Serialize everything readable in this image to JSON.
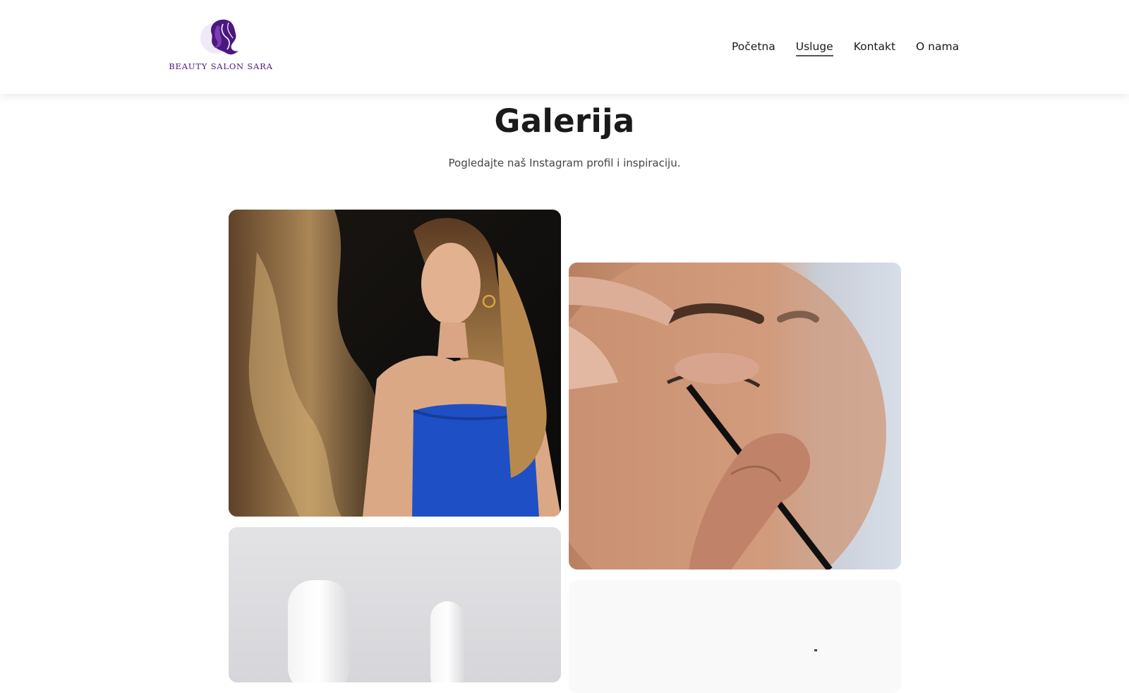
{
  "brand": {
    "name": "BEAUTY SALON SARA",
    "logo_icon": "woman-silhouette-icon",
    "accent": "#4b1780"
  },
  "nav": {
    "items": [
      {
        "label": "Početna",
        "active": false
      },
      {
        "label": "Usluge",
        "active": true
      },
      {
        "label": "Kontakt",
        "active": false
      },
      {
        "label": "O nama",
        "active": false
      }
    ]
  },
  "gallery": {
    "title": "Galerija",
    "subtitle": "Pogledajte naš Instagram profil i inspiraciju.",
    "tiles": [
      {
        "name": "gallery-photo-model-blue-dress"
      },
      {
        "name": "gallery-photo-eyeliner-application"
      },
      {
        "name": "gallery-photo-white-bottles"
      },
      {
        "name": "gallery-photo-light-product"
      }
    ]
  }
}
